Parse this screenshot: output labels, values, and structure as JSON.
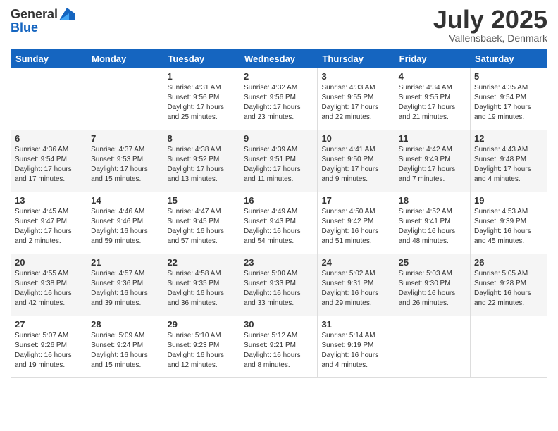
{
  "header": {
    "logo_general": "General",
    "logo_blue": "Blue",
    "month_title": "July 2025",
    "location": "Vallensbaek, Denmark"
  },
  "days_of_week": [
    "Sunday",
    "Monday",
    "Tuesday",
    "Wednesday",
    "Thursday",
    "Friday",
    "Saturday"
  ],
  "weeks": [
    [
      {
        "day": "",
        "info": ""
      },
      {
        "day": "",
        "info": ""
      },
      {
        "day": "1",
        "sunrise": "Sunrise: 4:31 AM",
        "sunset": "Sunset: 9:56 PM",
        "daylight": "Daylight: 17 hours and 25 minutes."
      },
      {
        "day": "2",
        "sunrise": "Sunrise: 4:32 AM",
        "sunset": "Sunset: 9:56 PM",
        "daylight": "Daylight: 17 hours and 23 minutes."
      },
      {
        "day": "3",
        "sunrise": "Sunrise: 4:33 AM",
        "sunset": "Sunset: 9:55 PM",
        "daylight": "Daylight: 17 hours and 22 minutes."
      },
      {
        "day": "4",
        "sunrise": "Sunrise: 4:34 AM",
        "sunset": "Sunset: 9:55 PM",
        "daylight": "Daylight: 17 hours and 21 minutes."
      },
      {
        "day": "5",
        "sunrise": "Sunrise: 4:35 AM",
        "sunset": "Sunset: 9:54 PM",
        "daylight": "Daylight: 17 hours and 19 minutes."
      }
    ],
    [
      {
        "day": "6",
        "sunrise": "Sunrise: 4:36 AM",
        "sunset": "Sunset: 9:54 PM",
        "daylight": "Daylight: 17 hours and 17 minutes."
      },
      {
        "day": "7",
        "sunrise": "Sunrise: 4:37 AM",
        "sunset": "Sunset: 9:53 PM",
        "daylight": "Daylight: 17 hours and 15 minutes."
      },
      {
        "day": "8",
        "sunrise": "Sunrise: 4:38 AM",
        "sunset": "Sunset: 9:52 PM",
        "daylight": "Daylight: 17 hours and 13 minutes."
      },
      {
        "day": "9",
        "sunrise": "Sunrise: 4:39 AM",
        "sunset": "Sunset: 9:51 PM",
        "daylight": "Daylight: 17 hours and 11 minutes."
      },
      {
        "day": "10",
        "sunrise": "Sunrise: 4:41 AM",
        "sunset": "Sunset: 9:50 PM",
        "daylight": "Daylight: 17 hours and 9 minutes."
      },
      {
        "day": "11",
        "sunrise": "Sunrise: 4:42 AM",
        "sunset": "Sunset: 9:49 PM",
        "daylight": "Daylight: 17 hours and 7 minutes."
      },
      {
        "day": "12",
        "sunrise": "Sunrise: 4:43 AM",
        "sunset": "Sunset: 9:48 PM",
        "daylight": "Daylight: 17 hours and 4 minutes."
      }
    ],
    [
      {
        "day": "13",
        "sunrise": "Sunrise: 4:45 AM",
        "sunset": "Sunset: 9:47 PM",
        "daylight": "Daylight: 17 hours and 2 minutes."
      },
      {
        "day": "14",
        "sunrise": "Sunrise: 4:46 AM",
        "sunset": "Sunset: 9:46 PM",
        "daylight": "Daylight: 16 hours and 59 minutes."
      },
      {
        "day": "15",
        "sunrise": "Sunrise: 4:47 AM",
        "sunset": "Sunset: 9:45 PM",
        "daylight": "Daylight: 16 hours and 57 minutes."
      },
      {
        "day": "16",
        "sunrise": "Sunrise: 4:49 AM",
        "sunset": "Sunset: 9:43 PM",
        "daylight": "Daylight: 16 hours and 54 minutes."
      },
      {
        "day": "17",
        "sunrise": "Sunrise: 4:50 AM",
        "sunset": "Sunset: 9:42 PM",
        "daylight": "Daylight: 16 hours and 51 minutes."
      },
      {
        "day": "18",
        "sunrise": "Sunrise: 4:52 AM",
        "sunset": "Sunset: 9:41 PM",
        "daylight": "Daylight: 16 hours and 48 minutes."
      },
      {
        "day": "19",
        "sunrise": "Sunrise: 4:53 AM",
        "sunset": "Sunset: 9:39 PM",
        "daylight": "Daylight: 16 hours and 45 minutes."
      }
    ],
    [
      {
        "day": "20",
        "sunrise": "Sunrise: 4:55 AM",
        "sunset": "Sunset: 9:38 PM",
        "daylight": "Daylight: 16 hours and 42 minutes."
      },
      {
        "day": "21",
        "sunrise": "Sunrise: 4:57 AM",
        "sunset": "Sunset: 9:36 PM",
        "daylight": "Daylight: 16 hours and 39 minutes."
      },
      {
        "day": "22",
        "sunrise": "Sunrise: 4:58 AM",
        "sunset": "Sunset: 9:35 PM",
        "daylight": "Daylight: 16 hours and 36 minutes."
      },
      {
        "day": "23",
        "sunrise": "Sunrise: 5:00 AM",
        "sunset": "Sunset: 9:33 PM",
        "daylight": "Daylight: 16 hours and 33 minutes."
      },
      {
        "day": "24",
        "sunrise": "Sunrise: 5:02 AM",
        "sunset": "Sunset: 9:31 PM",
        "daylight": "Daylight: 16 hours and 29 minutes."
      },
      {
        "day": "25",
        "sunrise": "Sunrise: 5:03 AM",
        "sunset": "Sunset: 9:30 PM",
        "daylight": "Daylight: 16 hours and 26 minutes."
      },
      {
        "day": "26",
        "sunrise": "Sunrise: 5:05 AM",
        "sunset": "Sunset: 9:28 PM",
        "daylight": "Daylight: 16 hours and 22 minutes."
      }
    ],
    [
      {
        "day": "27",
        "sunrise": "Sunrise: 5:07 AM",
        "sunset": "Sunset: 9:26 PM",
        "daylight": "Daylight: 16 hours and 19 minutes."
      },
      {
        "day": "28",
        "sunrise": "Sunrise: 5:09 AM",
        "sunset": "Sunset: 9:24 PM",
        "daylight": "Daylight: 16 hours and 15 minutes."
      },
      {
        "day": "29",
        "sunrise": "Sunrise: 5:10 AM",
        "sunset": "Sunset: 9:23 PM",
        "daylight": "Daylight: 16 hours and 12 minutes."
      },
      {
        "day": "30",
        "sunrise": "Sunrise: 5:12 AM",
        "sunset": "Sunset: 9:21 PM",
        "daylight": "Daylight: 16 hours and 8 minutes."
      },
      {
        "day": "31",
        "sunrise": "Sunrise: 5:14 AM",
        "sunset": "Sunset: 9:19 PM",
        "daylight": "Daylight: 16 hours and 4 minutes."
      },
      {
        "day": "",
        "info": ""
      },
      {
        "day": "",
        "info": ""
      }
    ]
  ]
}
